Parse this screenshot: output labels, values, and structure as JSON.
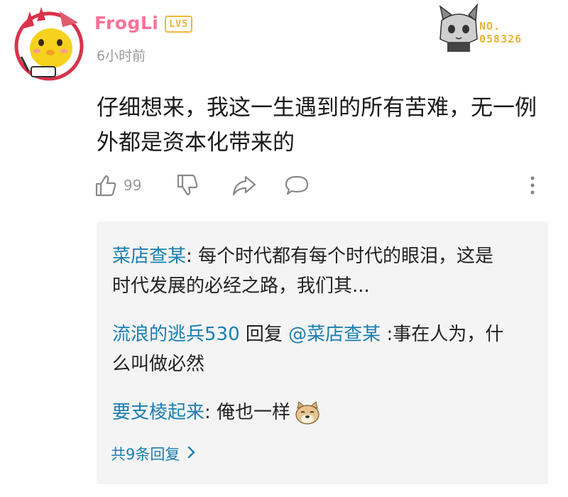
{
  "comment": {
    "username": "FrogLi",
    "level": "LV5",
    "time": "6小时前",
    "badge_label": "NO.",
    "badge_number": "058326",
    "content": "仔细想来，我这一生遇到的所有苦难，无一例外都是资本化带来的",
    "likes": "99"
  },
  "icons": {
    "like": "thumbs-up-icon",
    "dislike": "thumbs-down-icon",
    "share": "share-arrow-icon",
    "reply": "speech-bubble-icon",
    "more": "vertical-ellipsis-icon"
  },
  "replies": [
    {
      "user": "菜店查某",
      "text": ": 每个时代都有每个时代的眼泪，这是时代发展的必经之路，我们其..."
    },
    {
      "user": "流浪的逃兵530",
      "reply_word": " 回复 ",
      "mention": "@菜店查某",
      "text": " :事在人为，什么叫做必然"
    },
    {
      "user": "要支棱起来",
      "text": ": 俺也一样"
    }
  ],
  "more_replies": "共9条回复",
  "colors": {
    "username": "#fb7299",
    "level": "#f2b63d",
    "link": "#1a7fb1",
    "muted": "#999999",
    "reply_bg": "#f4f4f4"
  }
}
